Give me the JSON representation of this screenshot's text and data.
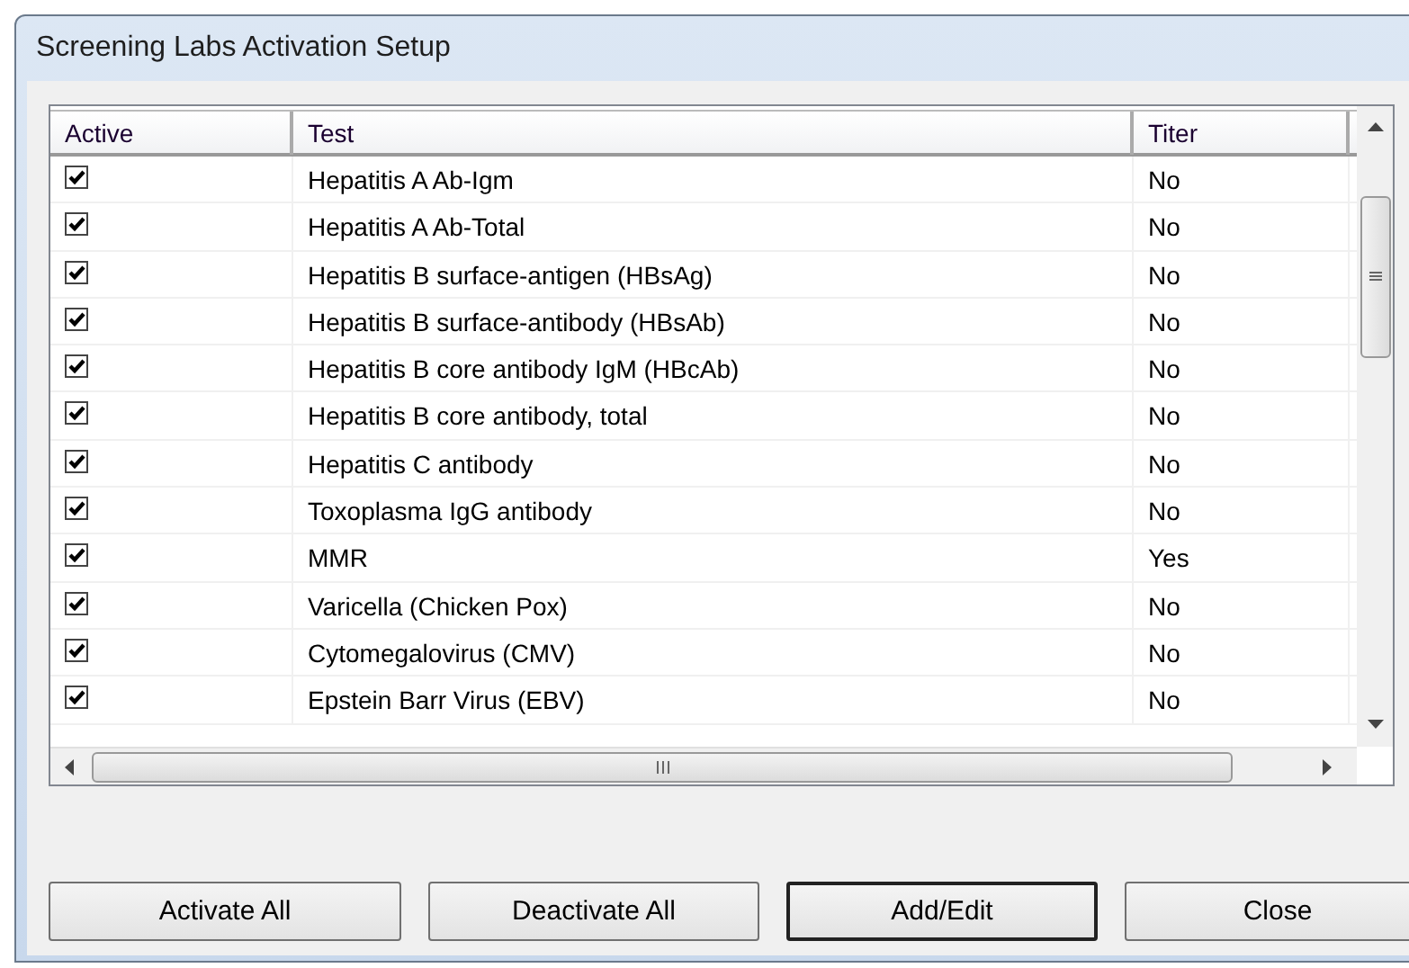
{
  "window": {
    "title": "Screening Labs Activation Setup"
  },
  "table": {
    "columns": [
      "Active",
      "Test",
      "Titer"
    ],
    "rows": [
      {
        "active": true,
        "test": "Hepatitis A Ab-Igm",
        "titer": "No"
      },
      {
        "active": true,
        "test": "Hepatitis A Ab-Total",
        "titer": "No"
      },
      {
        "active": true,
        "test": "Hepatitis B surface-antigen (HBsAg)",
        "titer": "No"
      },
      {
        "active": true,
        "test": "Hepatitis B surface-antibody (HBsAb)",
        "titer": "No"
      },
      {
        "active": true,
        "test": "Hepatitis B core antibody IgM (HBcAb)",
        "titer": "No"
      },
      {
        "active": true,
        "test": "Hepatitis B core antibody, total",
        "titer": "No"
      },
      {
        "active": true,
        "test": "Hepatitis C antibody",
        "titer": "No"
      },
      {
        "active": true,
        "test": "Toxoplasma IgG antibody",
        "titer": "No"
      },
      {
        "active": true,
        "test": "MMR",
        "titer": "Yes"
      },
      {
        "active": true,
        "test": "Varicella (Chicken Pox)",
        "titer": "No"
      },
      {
        "active": true,
        "test": "Cytomegalovirus (CMV)",
        "titer": "No"
      },
      {
        "active": true,
        "test": "Epstein Barr Virus (EBV)",
        "titer": "No"
      }
    ]
  },
  "buttons": [
    {
      "label": "Activate All",
      "default": false
    },
    {
      "label": "Deactivate All",
      "default": false
    },
    {
      "label": "Add/Edit",
      "default": true
    },
    {
      "label": "Close",
      "default": false
    }
  ]
}
